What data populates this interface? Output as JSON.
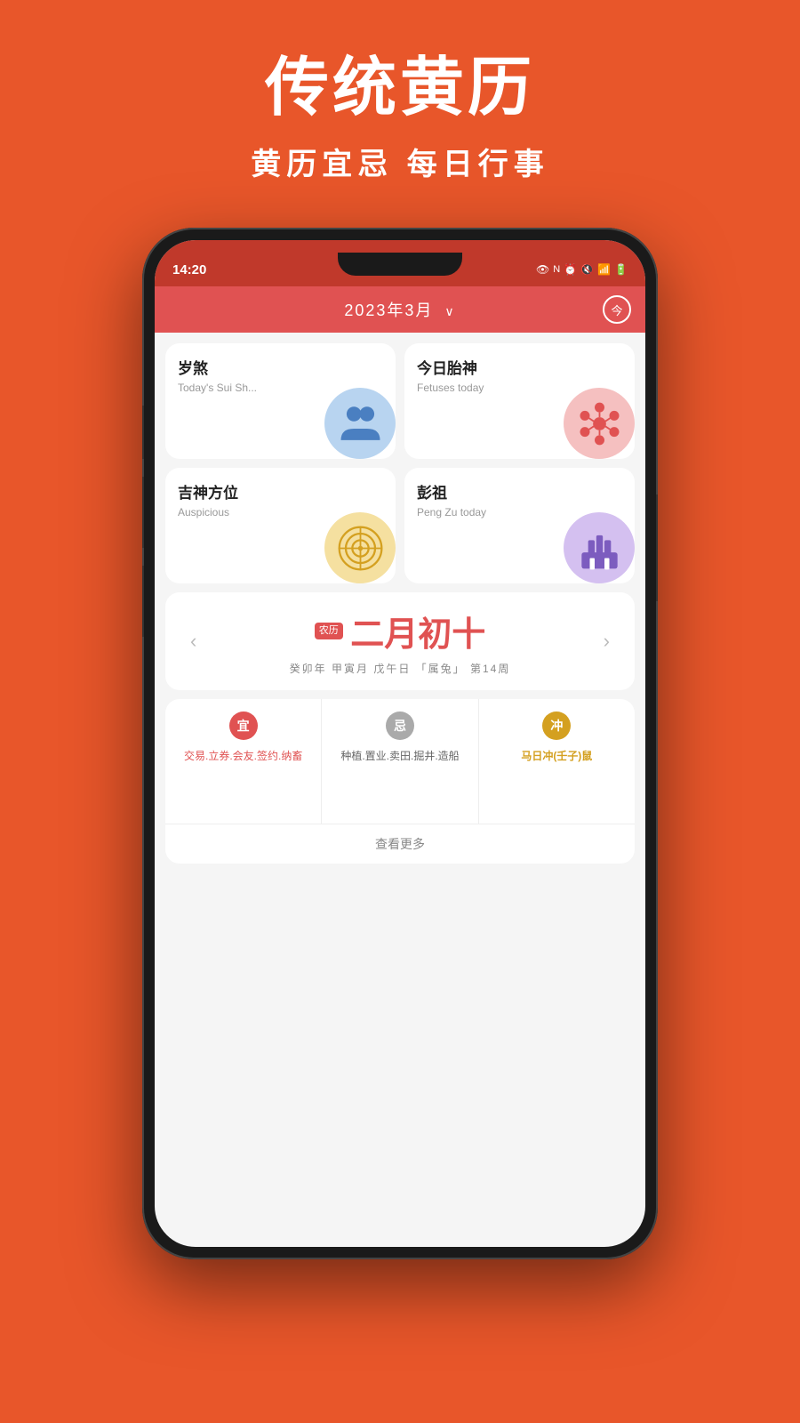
{
  "page": {
    "bg_color": "#E8562A",
    "title": "传统黄历",
    "subtitle": "黄历宜忌 每日行事"
  },
  "status_bar": {
    "time": "14:20",
    "icons": "👁 N ⏰ 🔇 📶 🔋"
  },
  "app_header": {
    "title": "2023年3月",
    "chevron": "∨",
    "today_btn": "今"
  },
  "cards": [
    {
      "id": "suishen",
      "title": "岁煞",
      "subtitle": "Today's Sui Sh...",
      "icon_type": "blue",
      "icon_name": "people-icon"
    },
    {
      "id": "fetuses",
      "title": "今日胎神",
      "subtitle": "Fetuses today",
      "icon_type": "pink",
      "icon_name": "molecule-icon"
    },
    {
      "id": "jishen",
      "title": "吉神方位",
      "subtitle": "Auspicious",
      "icon_type": "yellow",
      "icon_name": "radar-icon"
    },
    {
      "id": "pengzu",
      "title": "彭祖",
      "subtitle": "Peng Zu today",
      "icon_type": "purple",
      "icon_name": "factory-icon"
    }
  ],
  "lunar": {
    "tag": "农历",
    "date": "二月初十",
    "detail": "癸卯年 甲寅月 戊午日 「属兔」 第14周",
    "prev_label": "‹",
    "next_label": "›"
  },
  "yiji": {
    "columns": [
      {
        "badge": "宜",
        "badge_class": "badge-yi",
        "text": "交易.立券.会友.签约.纳畜",
        "text_class": "yiji-text"
      },
      {
        "badge": "忌",
        "badge_class": "badge-ji",
        "text": "种植.置业.卖田.掘井.造船",
        "text_class": "yiji-text-gray"
      },
      {
        "badge": "冲",
        "badge_class": "badge-chong",
        "text": "马日冲(壬子)鼠",
        "text_class": "yiji-text-gold"
      }
    ],
    "more_label": "查看更多"
  }
}
